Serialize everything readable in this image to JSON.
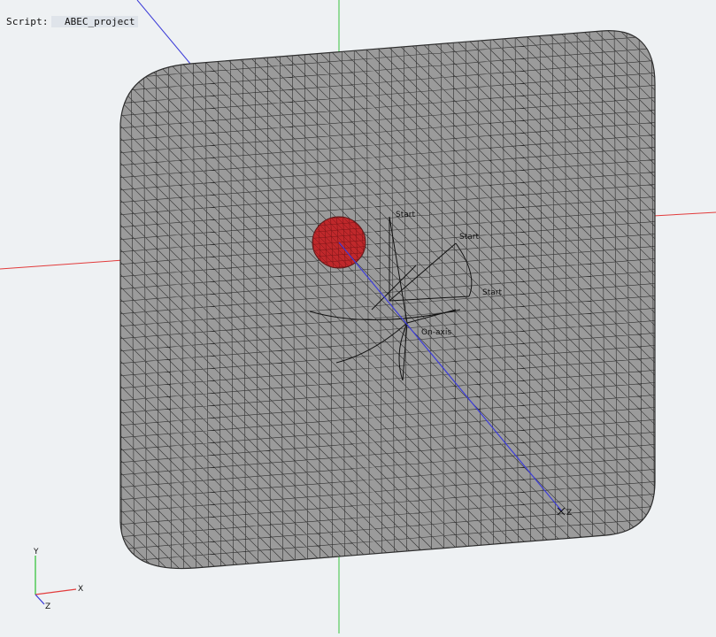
{
  "header": {
    "script_label": "Script:",
    "script_value": "ABEC_project"
  },
  "labels": {
    "start_1": "Start",
    "start_2": "Start",
    "start_3": "Start",
    "on_axis": "On-axis",
    "z_marker": "Z"
  },
  "triad": {
    "x": "X",
    "y": "Y",
    "z": "Z"
  },
  "colors": {
    "background": "#eef1f3",
    "mesh_fill": "#9b9b9b",
    "mesh_edge": "#2e2e2e",
    "driver": "#c0282b",
    "x_axis": "#e23b3b",
    "y_axis": "#39c43f",
    "z_axis": "#3c3cd8"
  }
}
